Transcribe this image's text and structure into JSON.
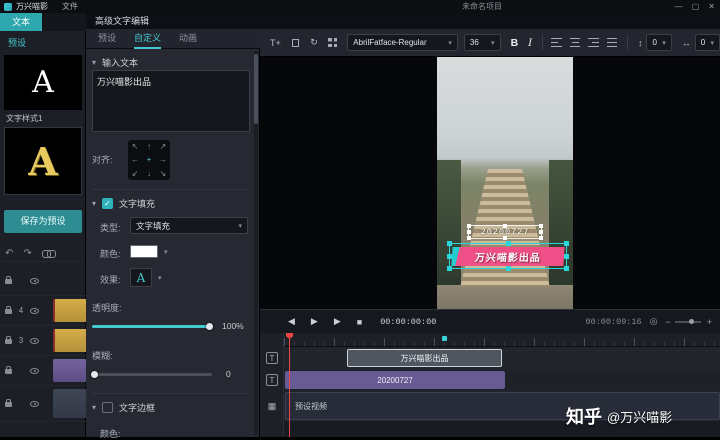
{
  "titlebar": {
    "app_name": "万兴喵影",
    "menu_file": "文件",
    "project_title": "未命名项目",
    "minimize": "—",
    "maximize": "▢",
    "close": "✕"
  },
  "left_panel": {
    "tab_text": "文本",
    "nav_preset": "预设",
    "style_card_1": {
      "glyph": "A",
      "label": "文字样式1"
    },
    "style_card_2": {
      "glyph": "A"
    },
    "save_preset": "保存为预设",
    "track_headers": [
      {
        "num": ""
      },
      {
        "num": "4"
      },
      {
        "num": "3"
      },
      {
        "num": ""
      },
      {
        "num": ""
      }
    ]
  },
  "editor_panel": {
    "title": "高级文字编辑",
    "tab_preset": "预设",
    "tab_custom": "自定义",
    "tab_anim": "动画",
    "input_section": "输入文本",
    "input_text": "万兴喵影出品",
    "align_label": "对齐:",
    "fill": {
      "section": "文字填充",
      "type_label": "类型:",
      "type_value": "文字填充",
      "color_label": "颜色:",
      "effect_label": "效果:",
      "effect_glyph": "A",
      "opacity_label": "透明度:",
      "opacity_value": "100%",
      "blur_label": "模糊:",
      "blur_value": "0"
    },
    "border": {
      "section": "文字边框",
      "color_label": "颜色:"
    }
  },
  "font_toolbar": {
    "add_text": "T+",
    "font_family": "AbrilFatface-Regular",
    "font_size": "36",
    "bold": "B",
    "italic": "I",
    "line_spacing": "0",
    "letter_spacing": "0"
  },
  "preview": {
    "date_text": "20200727",
    "banner_text": "万兴喵影出品"
  },
  "playback": {
    "current": "00:00:00:00",
    "duration": "00:00:09:16"
  },
  "timeline": {
    "clip_title": "万兴喵影出品",
    "clip_date": "20200727",
    "clip_video": "预设视频",
    "track_type_text": "T"
  },
  "watermark": {
    "brand": "知乎",
    "handle": "@万兴喵影"
  },
  "icons": {
    "caret": "▾",
    "section_arrow": "▾",
    "check": "✓",
    "undo": "↶",
    "redo": "↷",
    "rotate": "↻",
    "prev": "◀",
    "play": "▶",
    "next": "▶",
    "stop": "■",
    "snapshot": "◎",
    "minus": "−",
    "plus": "+",
    "vspace": "↕",
    "hspace": "↔",
    "film": "▦",
    "align_grid": [
      "↖",
      "↑",
      "↗",
      "←",
      "+",
      "→",
      "↙",
      "↓",
      "↘"
    ]
  },
  "colors": {
    "accent": "#45c8cd",
    "banner_pink": "#ee4f87",
    "clip_purple": "#685b94",
    "clip_gold": "#c9a23f",
    "playhead_red": "#ef4444"
  }
}
